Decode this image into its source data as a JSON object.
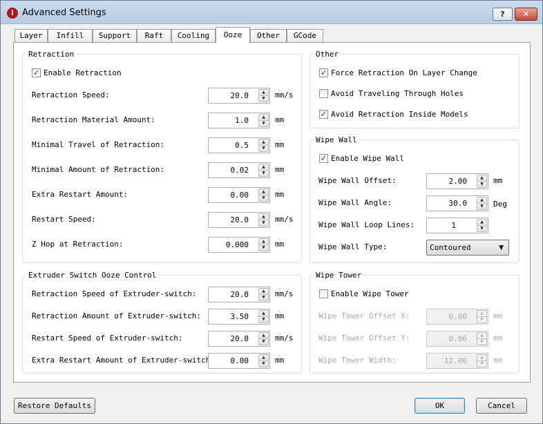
{
  "window": {
    "title": "Advanced Settings",
    "help_label": "?",
    "close_label": "✕",
    "app_icon_glyph": "i",
    "app_icon_color": "#b0181c"
  },
  "tabs": [
    {
      "label": "Layer"
    },
    {
      "label": "Infill"
    },
    {
      "label": "Support"
    },
    {
      "label": "Raft"
    },
    {
      "label": "Cooling"
    },
    {
      "label": "Ooze",
      "active": true
    },
    {
      "label": "Other"
    },
    {
      "label": "GCode"
    }
  ],
  "retraction": {
    "title": "Retraction",
    "enable": {
      "label": "Enable Retraction",
      "checked": true
    },
    "fields": [
      {
        "label": "Retraction Speed:",
        "value": "20.0",
        "unit": "mm/s"
      },
      {
        "label": "Retraction Material Amount:",
        "value": "1.0",
        "unit": "mm"
      },
      {
        "label": "Minimal Travel of Retraction:",
        "value": "0.5",
        "unit": "mm"
      },
      {
        "label": "Minimal Amount of Retraction:",
        "value": "0.02",
        "unit": "mm"
      },
      {
        "label": "Extra Restart Amount:",
        "value": "0.00",
        "unit": "mm"
      },
      {
        "label": "Restart Speed:",
        "value": "20.0",
        "unit": "mm/s"
      },
      {
        "label": "Z Hop at Retraction:",
        "value": "0.000",
        "unit": "mm"
      }
    ]
  },
  "extruder_switch": {
    "title": "Extruder Switch Ooze Control",
    "fields": [
      {
        "label": "Retraction Speed of Extruder-switch:",
        "value": "20.0",
        "unit": "mm/s"
      },
      {
        "label": "Retraction Amount of Extruder-switch:",
        "value": "3.50",
        "unit": "mm"
      },
      {
        "label": "Restart Speed of Extruder-switch:",
        "value": "20.0",
        "unit": "mm/s"
      },
      {
        "label": "Extra Restart Amount of Extruder-switch:",
        "value": "0.00",
        "unit": "mm"
      }
    ]
  },
  "other": {
    "title": "Other",
    "checkboxes": [
      {
        "label": "Force Retraction On Layer Change",
        "checked": true
      },
      {
        "label": "Avoid Traveling Through Holes",
        "checked": false
      },
      {
        "label": "Avoid Retraction Inside Models",
        "checked": true
      }
    ]
  },
  "wipe_wall": {
    "title": "Wipe Wall",
    "enable": {
      "label": "Enable Wipe Wall",
      "checked": true
    },
    "fields": [
      {
        "label": "Wipe Wall Offset:",
        "value": "2.00",
        "unit": "mm"
      },
      {
        "label": "Wipe Wall Angle:",
        "value": "30.0",
        "unit": "Deg"
      },
      {
        "label": "Wipe Wall Loop Lines:",
        "value": "1",
        "unit": ""
      }
    ],
    "type": {
      "label": "Wipe Wall Type:",
      "value": "Contoured"
    }
  },
  "wipe_tower": {
    "title": "Wipe Tower",
    "enable": {
      "label": "Enable Wipe Tower",
      "checked": false
    },
    "fields": [
      {
        "label": "Wipe Tower Offset X:",
        "value": "0.00",
        "unit": "mm",
        "disabled": true
      },
      {
        "label": "Wipe Tower Offset Y:",
        "value": "0.00",
        "unit": "mm",
        "disabled": true
      },
      {
        "label": "Wipe Tower Width:",
        "value": "12.00",
        "unit": "mm",
        "disabled": true
      }
    ]
  },
  "buttons": {
    "restore_defaults": "Restore Defaults",
    "ok": "OK",
    "cancel": "Cancel"
  },
  "check_glyph": "✓"
}
